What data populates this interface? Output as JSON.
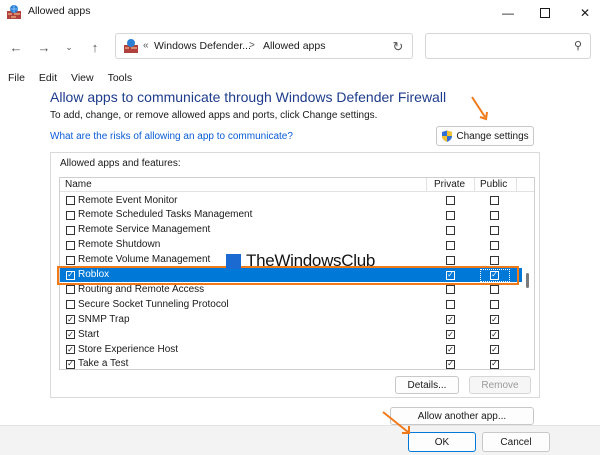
{
  "window": {
    "title": "Allowed apps"
  },
  "address": {
    "sep0": "«",
    "crumb1": "Windows Defender...",
    "sep1": ">",
    "crumb2": "Allowed apps"
  },
  "menubar": [
    "File",
    "Edit",
    "View",
    "Tools"
  ],
  "content": {
    "heading": "Allow apps to communicate through Windows Defender Firewall",
    "subtext": "To add, change, or remove allowed apps and ports, click Change settings.",
    "risk_link": "What are the risks of allowing an app to communicate?",
    "change_settings": "Change settings",
    "group_label": "Allowed apps and features:",
    "columns": {
      "name": "Name",
      "private": "Private",
      "public": "Public"
    },
    "rows": [
      {
        "label": "Remote Event Monitor",
        "checked": false,
        "private": false,
        "public": false
      },
      {
        "label": "Remote Scheduled Tasks Management",
        "checked": false,
        "private": false,
        "public": false
      },
      {
        "label": "Remote Service Management",
        "checked": false,
        "private": false,
        "public": false
      },
      {
        "label": "Remote Shutdown",
        "checked": false,
        "private": false,
        "public": false
      },
      {
        "label": "Remote Volume Management",
        "checked": false,
        "private": false,
        "public": false
      },
      {
        "label": "Roblox",
        "checked": true,
        "private": true,
        "public": true,
        "selected": true
      },
      {
        "label": "Routing and Remote Access",
        "checked": false,
        "private": false,
        "public": false
      },
      {
        "label": "Secure Socket Tunneling Protocol",
        "checked": false,
        "private": false,
        "public": false
      },
      {
        "label": "SNMP Trap",
        "checked": true,
        "private": true,
        "public": true
      },
      {
        "label": "Start",
        "checked": true,
        "private": true,
        "public": true
      },
      {
        "label": "Store Experience Host",
        "checked": true,
        "private": true,
        "public": true
      },
      {
        "label": "Take a Test",
        "checked": true,
        "private": true,
        "public": true
      }
    ],
    "details": "Details...",
    "remove": "Remove",
    "allow_another": "Allow another app..."
  },
  "footer": {
    "ok": "OK",
    "cancel": "Cancel"
  },
  "watermark": "TheWindowsClub",
  "colors": {
    "accent": "#0078d7",
    "highlight": "#f07a1a",
    "heading": "#1e3c8c",
    "link": "#0a5cd6"
  }
}
